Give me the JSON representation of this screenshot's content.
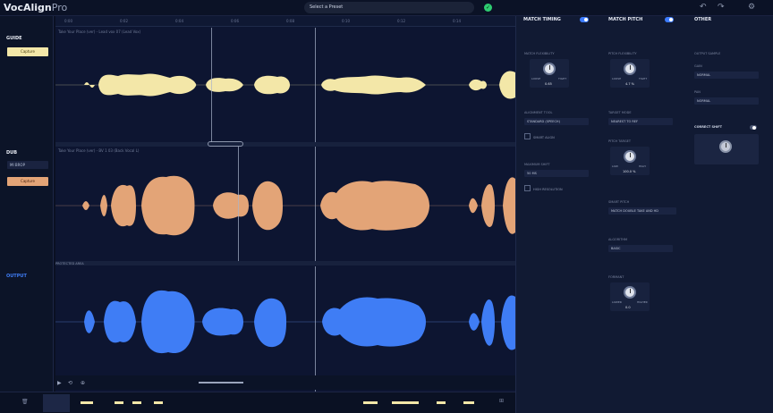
{
  "app": {
    "name": "VocAlign",
    "suffix": "Pro"
  },
  "preset": {
    "label": "Select a Preset"
  },
  "tracks": {
    "guide": {
      "name": "GUIDE",
      "capture": "Capture",
      "clip": "Take Your Place (ver) - Lead vox 07 (Lead Vox)"
    },
    "dub": {
      "name": "DUB",
      "mode": "MI BROP",
      "capture": "Capture",
      "clip": "Take Your Place (ver) - BV 1 03 (Back Vocal L)"
    },
    "output": {
      "name": "OUTPUT",
      "protected": "PROTECTED AREA"
    }
  },
  "ruler": [
    "0:00",
    "0:02",
    "0:04",
    "0:06",
    "0:08",
    "0:10",
    "0:12",
    "0:14"
  ],
  "timing": {
    "title": "MATCH TIMING",
    "flex_label": "MATCH FLEXIBILITY",
    "knob_left": "LOOSE",
    "knob_right": "TIGHT",
    "knob_value": "0.65",
    "algo_label": "ALIGNMENT TOOL",
    "algo_value": "STANDARD (SPEECH)",
    "smart_align": "SMART ALIGN",
    "shift_label": "MAXIMUM SHIFT",
    "shift_value": "50 MS",
    "high_res": "HIGH RESOLUTION"
  },
  "pitch": {
    "title": "MATCH PITCH",
    "flex_label": "PITCH FLEXIBILITY",
    "knob_left": "LOOSE",
    "knob_right": "TIGHT",
    "knob_value": "4.7 %",
    "range_label": "TARGET MODE",
    "range_value": "NEAREST TO REF",
    "target_label": "PITCH TARGET",
    "target_left": "LOW",
    "target_right": "HIGH",
    "target_value": "100.0 %",
    "preset_label": "SMART PITCH",
    "preset_value": "MATCH DOUBLE TAKE AND HD",
    "algo_label": "ALGORITHM",
    "algo_value": "BASIC",
    "formant_label": "FORMANT",
    "formant_left": "LOWER",
    "formant_right": "HIGHER",
    "formant_value": "0.0"
  },
  "other": {
    "title": "OTHER",
    "output_label": "OUTPUT SAMPLE",
    "gain_label": "GAIN",
    "gain_value": "NORMAL",
    "pan_label": "PAN",
    "pan_value": "NORMAL",
    "correct_label": "CORRECT SHIFT"
  },
  "colors": {
    "guide": "#f3e7a8",
    "dub": "#e3a477",
    "output": "#3f7df5",
    "accent": "#3d7cff"
  }
}
